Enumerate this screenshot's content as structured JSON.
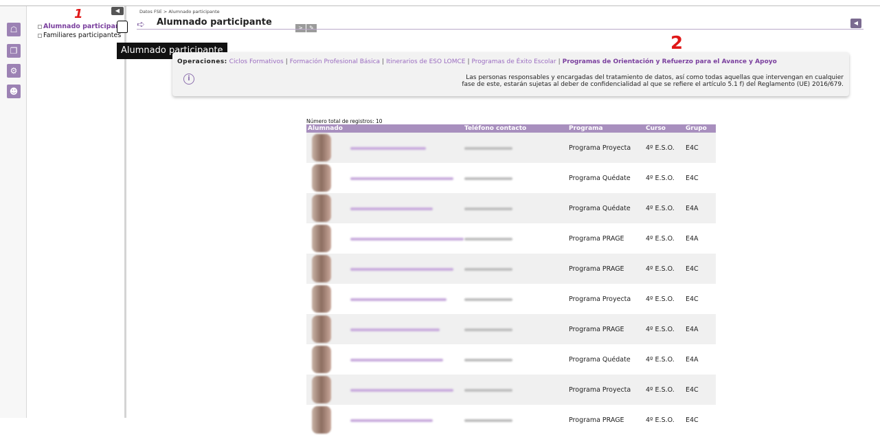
{
  "breadcrumb": "Datos FSE > Alumnado participante",
  "page_title": "Alumnado participante",
  "menu": {
    "items": [
      {
        "label": "Alumnado participante"
      },
      {
        "label": "Familiares participantes"
      }
    ]
  },
  "tooltip": "Alumnado participante",
  "annotations": {
    "one": "1",
    "two": "2"
  },
  "operations": {
    "label": "Operaciones:",
    "links": [
      {
        "label": "Ciclos Formativos"
      },
      {
        "label": "Formación Profesional Básica"
      },
      {
        "label": "Itinerarios de ESO LOMCE"
      },
      {
        "label": "Programas de Éxito Escolar"
      },
      {
        "label": "Programas de Orientación y Refuerzo para el Avance y Apoyo"
      }
    ],
    "notice_line1": "Las personas responsables y encargadas del tratamiento de datos, así como todas aquellas que intervengan en cualquier",
    "notice_line2": "fase de este, estarán sujetas al deber de confidencialidad al que se refiere el artículo 5.1 f) del Reglamento (UE) 2016/679."
  },
  "table": {
    "total_label": "Número total de registros: 10",
    "headers": {
      "alumnado": "Alumnado",
      "telefono": "Teléfono contacto",
      "programa": "Programa",
      "curso": "Curso",
      "grupo": "Grupo"
    },
    "rows": [
      {
        "programa": "Programa Proyecta",
        "curso": "4º E.S.O.",
        "grupo": "E4C"
      },
      {
        "programa": "Programa Quédate",
        "curso": "4º E.S.O.",
        "grupo": "E4C"
      },
      {
        "programa": "Programa Quédate",
        "curso": "4º E.S.O.",
        "grupo": "E4A"
      },
      {
        "programa": "Programa PRAGE",
        "curso": "4º E.S.O.",
        "grupo": "E4A"
      },
      {
        "programa": "Programa PRAGE",
        "curso": "4º E.S.O.",
        "grupo": "E4C"
      },
      {
        "programa": "Programa Proyecta",
        "curso": "4º E.S.O.",
        "grupo": "E4C"
      },
      {
        "programa": "Programa PRAGE",
        "curso": "4º E.S.O.",
        "grupo": "E4A"
      },
      {
        "programa": "Programa Quédate",
        "curso": "4º E.S.O.",
        "grupo": "E4A"
      },
      {
        "programa": "Programa Proyecta",
        "curso": "4º E.S.O.",
        "grupo": "E4C"
      },
      {
        "programa": "Programa PRAGE",
        "curso": "4º E.S.O.",
        "grupo": "E4C"
      }
    ]
  },
  "icons": {
    "rail": [
      "home-icon",
      "copy-icon",
      "gear-icon",
      "user-icon"
    ],
    "info": "info-icon"
  },
  "colors": {
    "accent": "#7a3f9e",
    "header_bg": "#a88fbe",
    "annotation": "#e01818"
  }
}
